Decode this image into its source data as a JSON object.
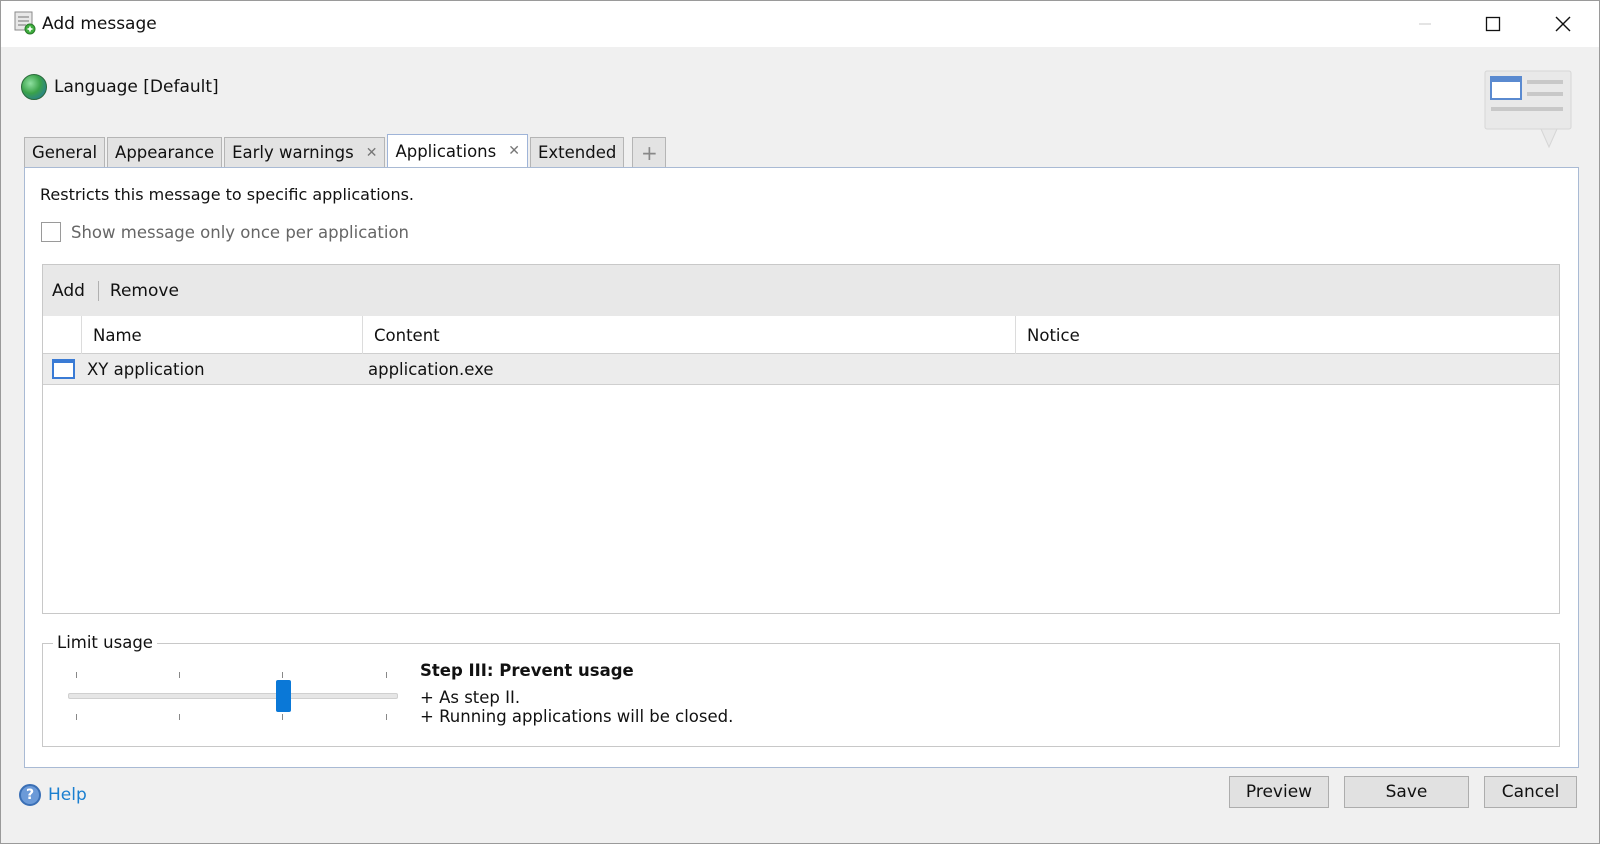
{
  "window": {
    "title": "Add message",
    "icons": {
      "app": "message-add-icon",
      "minimize": "minimize-icon",
      "maximize": "maximize-icon",
      "close": "close-icon"
    }
  },
  "language": {
    "label": "Language [Default]",
    "icon": "globe-icon"
  },
  "tabs": [
    {
      "label": "General",
      "closable": false,
      "active": false
    },
    {
      "label": "Appearance",
      "closable": false,
      "active": false
    },
    {
      "label": "Early warnings",
      "closable": true,
      "active": false
    },
    {
      "label": "Applications",
      "closable": true,
      "active": true
    },
    {
      "label": "Extended",
      "closable": false,
      "active": false
    }
  ],
  "tab_close_glyph": "✕",
  "tab_add_glyph": "+",
  "panel": {
    "description": "Restricts this message to specific applications.",
    "checkbox": {
      "label": "Show message only once per application",
      "checked": false
    }
  },
  "grid": {
    "toolbar": {
      "add": "Add",
      "remove": "Remove"
    },
    "columns": [
      "Name",
      "Content",
      "Notice"
    ],
    "rows": [
      {
        "name": "XY application",
        "content": "application.exe",
        "notice": "",
        "icon": "window-icon"
      }
    ]
  },
  "limit_usage": {
    "label": "Limit usage",
    "slider": {
      "steps": 4,
      "value": 3
    },
    "step_title": "Step III: Prevent usage",
    "step_lines": [
      "+ As step II.",
      "+ Running applications will be closed."
    ]
  },
  "footer": {
    "help": "Help",
    "preview": "Preview",
    "save": "Save",
    "cancel": "Cancel"
  },
  "colors": {
    "accent": "#0a78d7",
    "link": "#1a7fd0"
  }
}
